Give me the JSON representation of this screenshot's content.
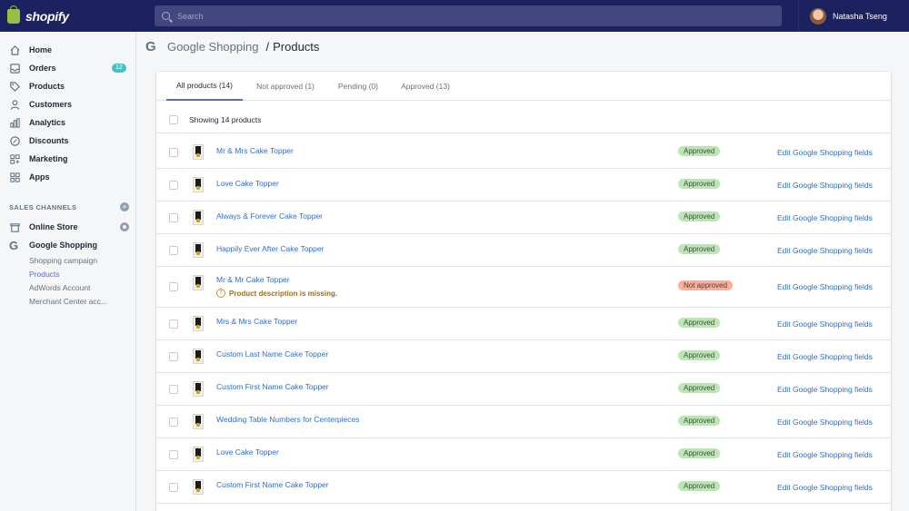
{
  "topbar": {
    "brand": "shopify",
    "search_placeholder": "Search",
    "user_name": "Natasha Tseng"
  },
  "sidebar": {
    "items": [
      {
        "label": "Home",
        "icon": "home-icon"
      },
      {
        "label": "Orders",
        "icon": "orders-icon",
        "badge": "12"
      },
      {
        "label": "Products",
        "icon": "tag-icon"
      },
      {
        "label": "Customers",
        "icon": "person-icon"
      },
      {
        "label": "Analytics",
        "icon": "bar-chart-icon"
      },
      {
        "label": "Discounts",
        "icon": "discount-icon"
      },
      {
        "label": "Marketing",
        "icon": "marketing-icon"
      },
      {
        "label": "Apps",
        "icon": "apps-icon"
      }
    ],
    "sales_channels_title": "SALES CHANNELS",
    "channels": [
      {
        "label": "Online Store",
        "icon": "store-icon"
      },
      {
        "label": "Google Shopping",
        "icon": "google-icon"
      }
    ],
    "sub_items": [
      "Shopping campaign",
      "Products",
      "AdWords Account",
      "Merchant Center acc..."
    ]
  },
  "breadcrumb": {
    "parent": "Google Shopping",
    "separator": "/",
    "current": "Products"
  },
  "tabs": [
    "All products (14)",
    "Not approved (1)",
    "Pending (0)",
    "Approved (13)"
  ],
  "list": {
    "showing_text": "Showing 14 products",
    "edit_label": "Edit Google Shopping fields",
    "rows": [
      {
        "name": "Mr & Mrs Cake Topper",
        "status": "Approved"
      },
      {
        "name": "Love Cake Topper",
        "status": "Approved"
      },
      {
        "name": "Always & Forever Cake Topper",
        "status": "Approved"
      },
      {
        "name": "Happily Ever After Cake Topper",
        "status": "Approved"
      },
      {
        "name": "Mr & Mr Cake Topper",
        "status": "Not approved",
        "warning": "Product description is missing."
      },
      {
        "name": "Mrs & Mrs Cake Topper",
        "status": "Approved"
      },
      {
        "name": "Custom Last Name Cake Topper",
        "status": "Approved"
      },
      {
        "name": "Custom First Name Cake Topper",
        "status": "Approved"
      },
      {
        "name": "Wedding Table Numbers for Centerpieces",
        "status": "Approved"
      },
      {
        "name": "Love Cake Topper",
        "status": "Approved"
      },
      {
        "name": "Custom First Name Cake Topper",
        "status": "Approved"
      }
    ]
  },
  "colors": {
    "topbar": "#1c2260",
    "accent": "#5c6ac4",
    "link": "#2c6ecb",
    "approved_badge": "#bbe5b3",
    "not_approved_badge": "#fead9a",
    "orders_badge": "#47c1bf"
  }
}
